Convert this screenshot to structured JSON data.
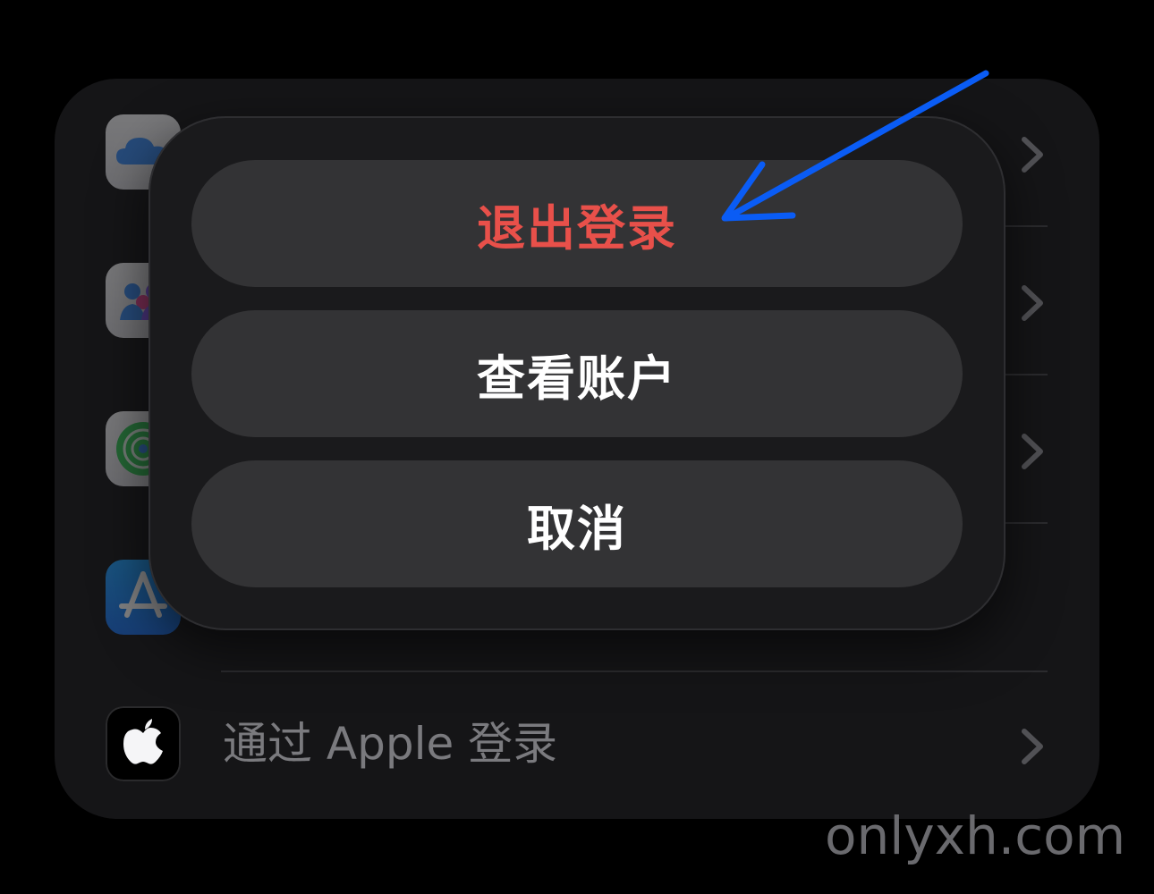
{
  "settings_list": {
    "rows": [
      {
        "icon": "icloud-icon"
      },
      {
        "icon": "family-sharing-icon"
      },
      {
        "icon": "find-my-icon"
      },
      {
        "icon": "app-store-icon",
        "status": "loading-spinner"
      },
      {
        "icon": "apple-logo-icon",
        "label": "通过 Apple 登录"
      }
    ]
  },
  "action_sheet": {
    "sign_out_label": "退出登录",
    "view_account_label": "查看账户",
    "cancel_label": "取消",
    "destructive_color": "#e8504a"
  },
  "annotation": {
    "arrow_color": "#0a5cf5"
  },
  "watermark": {
    "text": "onlyxh.com"
  }
}
